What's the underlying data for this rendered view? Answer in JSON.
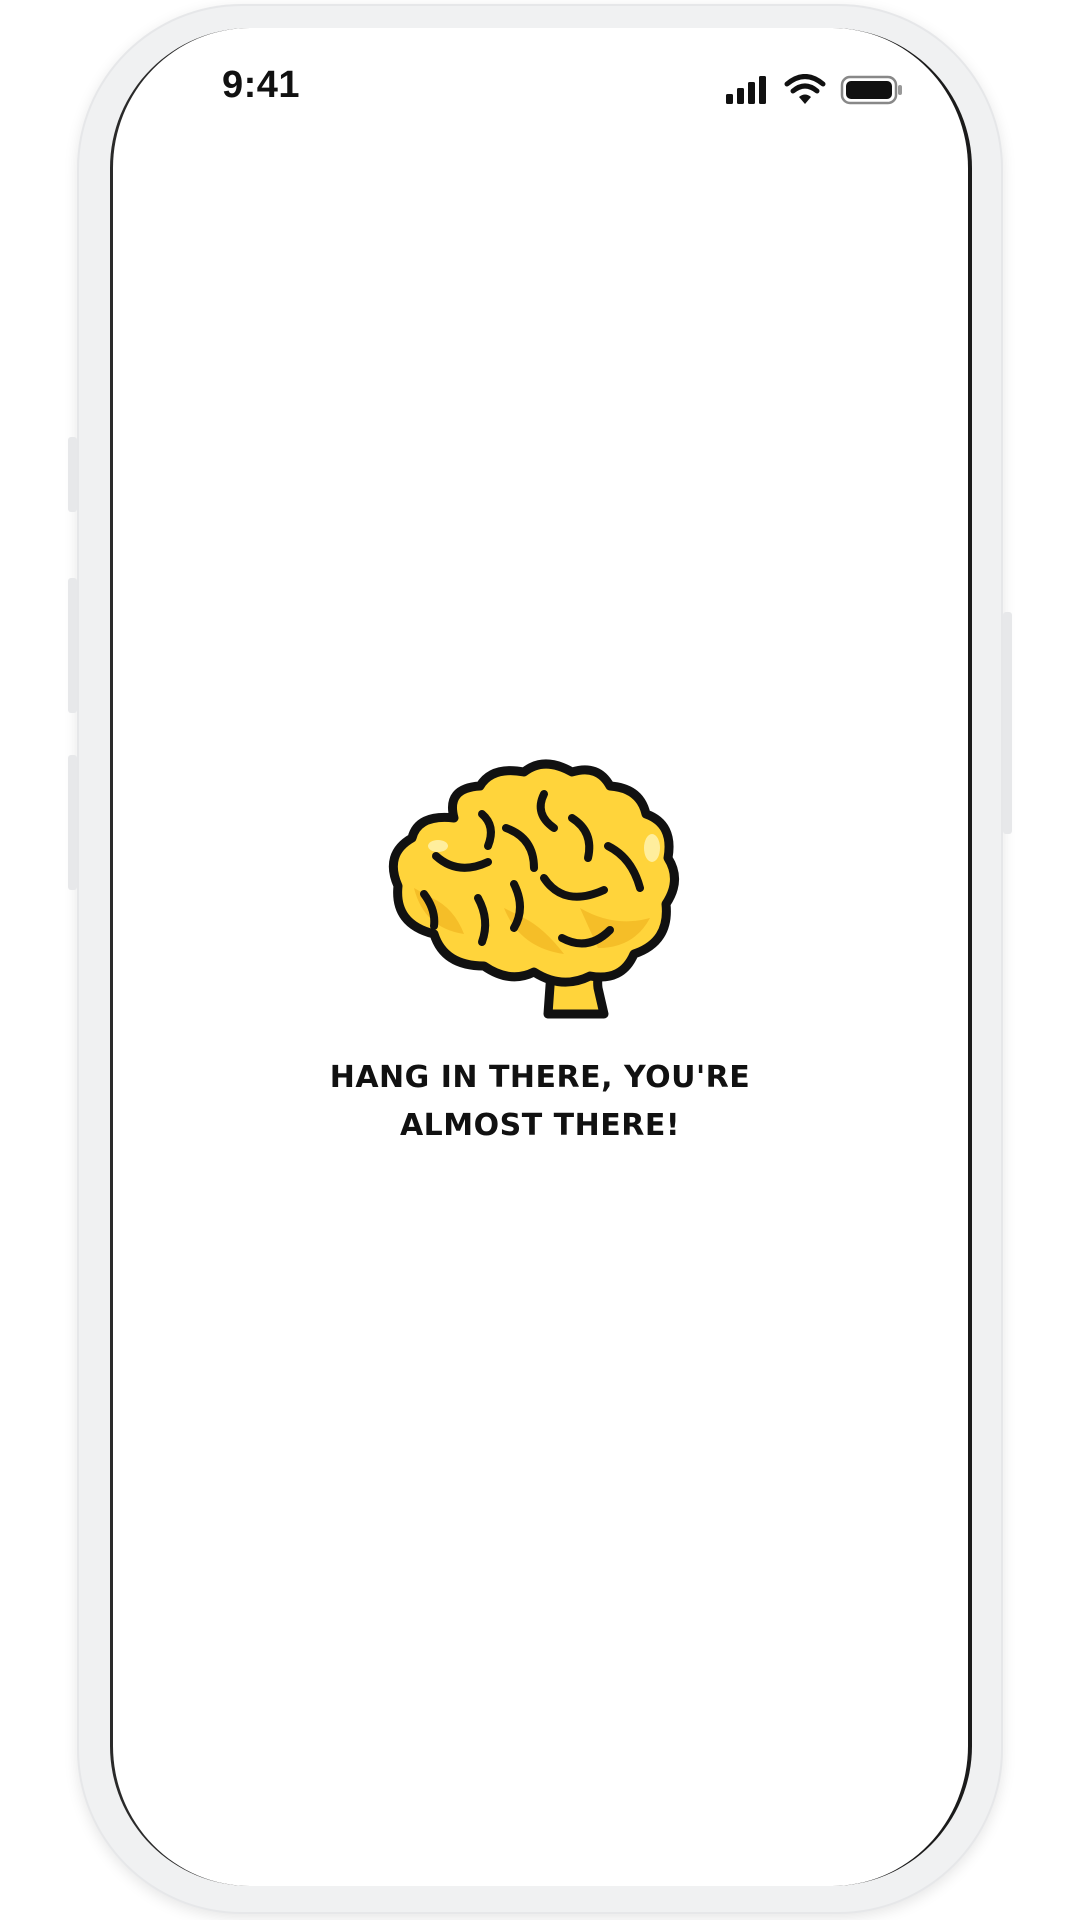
{
  "status_bar": {
    "time": "9:41",
    "icons": [
      "cellular-signal-icon",
      "wifi-icon",
      "battery-icon"
    ]
  },
  "main": {
    "illustration": "brain-icon",
    "message_line1": "HANG IN THERE, YOU'RE",
    "message_line2": "ALMOST THERE!"
  },
  "colors": {
    "brain_fill": "#FFD43B",
    "brain_shadow": "#F2B824",
    "outline": "#111111",
    "background": "#FFFFFF"
  }
}
